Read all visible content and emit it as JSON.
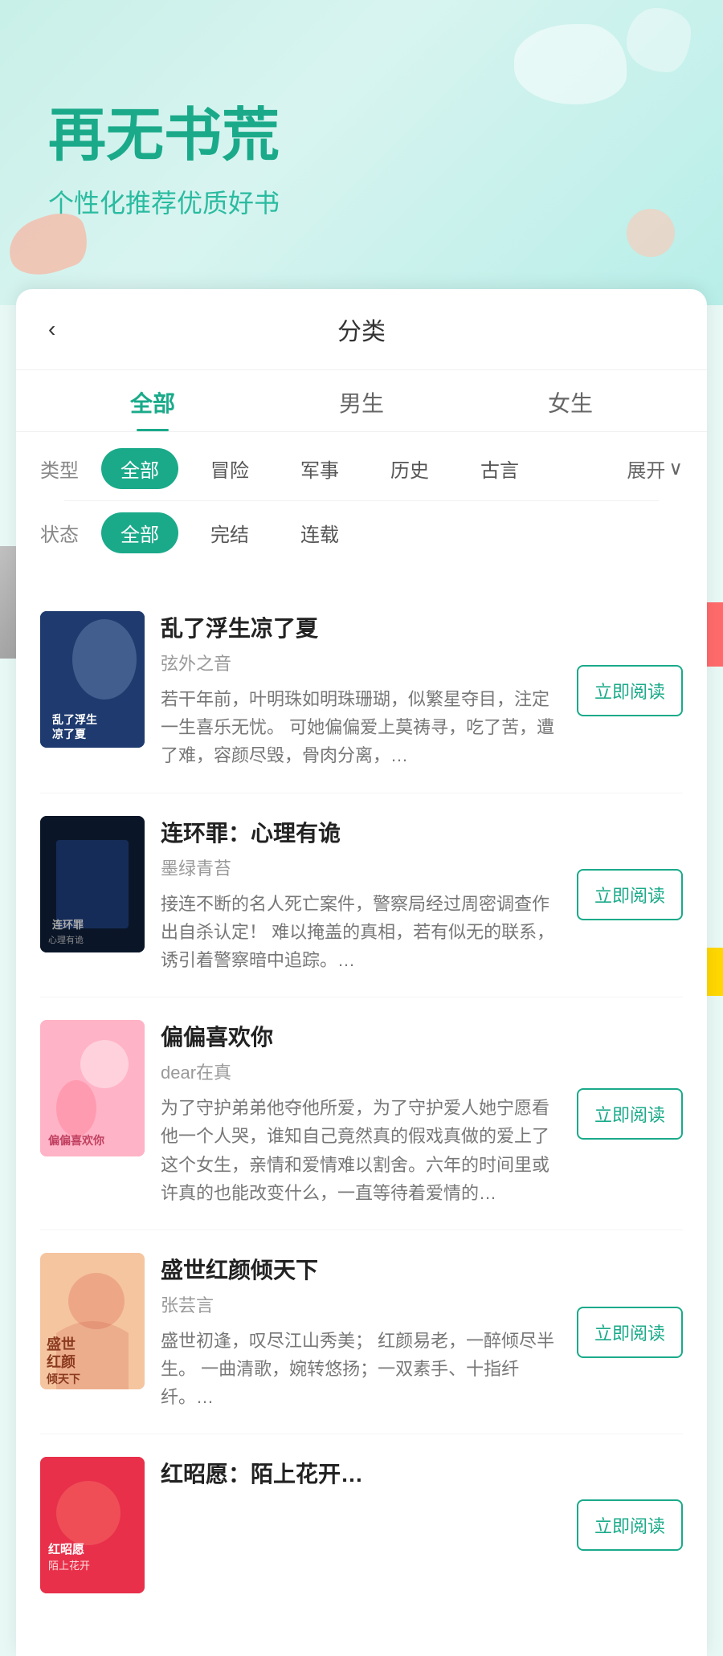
{
  "hero": {
    "title": "再无书荒",
    "subtitle": "个性化推荐优质好书"
  },
  "header": {
    "back_label": "‹",
    "title": "分类"
  },
  "tabs": [
    {
      "id": "all",
      "label": "全部",
      "active": true
    },
    {
      "id": "male",
      "label": "男生",
      "active": false
    },
    {
      "id": "female",
      "label": "女生",
      "active": false
    }
  ],
  "filters": {
    "type": {
      "label": "类型",
      "expand_label": "展开",
      "options": [
        {
          "id": "all",
          "label": "全部",
          "active": true
        },
        {
          "id": "adventure",
          "label": "冒险",
          "active": false
        },
        {
          "id": "military",
          "label": "军事",
          "active": false
        },
        {
          "id": "history",
          "label": "历史",
          "active": false
        },
        {
          "id": "ancient",
          "label": "古言",
          "active": false
        }
      ]
    },
    "status": {
      "label": "状态",
      "options": [
        {
          "id": "all",
          "label": "全部",
          "active": true
        },
        {
          "id": "completed",
          "label": "完结",
          "active": false
        },
        {
          "id": "ongoing",
          "label": "连载",
          "active": false
        }
      ]
    }
  },
  "books": [
    {
      "id": 1,
      "title": "乱了浮生凉了夏",
      "author": "弦外之音",
      "description": "若干年前，叶明珠如明珠珊瑚，似繁星夺目，注定一生喜乐无忧。\n可她偏偏爱上莫祷寻，吃了苦，遭了难，容颜尽毁，骨肉分离，…",
      "cover_style": "cover-1",
      "cover_text": "乱了浮生\n凉了夏",
      "read_btn": "立即阅读"
    },
    {
      "id": 2,
      "title": "连环罪：心理有诡",
      "author": "墨绿青苔",
      "description": "接连不断的名人死亡案件，警察局经过周密调查作出自杀认定！\n难以掩盖的真相，若有似无的联系，诱引着警察暗中追踪。…",
      "cover_style": "cover-2",
      "cover_text": "连环罪\n心理有诡",
      "read_btn": "立即阅读"
    },
    {
      "id": 3,
      "title": "偏偏喜欢你",
      "author": "dear在真",
      "description": "为了守护弟弟他夺他所爱，为了守护爱人她宁愿看他一个人哭，谁知自己竟然真的假戏真做的爱上了这个女生，亲情和爱情难以割舍。六年的时间里或许真的也能改变什么，一直等待着爱情的…",
      "cover_style": "cover-3",
      "cover_text": "偏偏喜欢你",
      "read_btn": "立即阅读"
    },
    {
      "id": 4,
      "title": "盛世红颜倾天下",
      "author": "张芸言",
      "description": "盛世初逢，叹尽江山秀美；\n红颜易老，一醉倾尽半生。\n一曲清歌，婉转悠扬；一双素手、十指纤纤。…",
      "cover_style": "cover-4",
      "cover_text": "盛世\n红颜\n倾天下",
      "read_btn": "立即阅读"
    },
    {
      "id": 5,
      "title": "红昭愿：陌上花开…",
      "author": "",
      "description": "",
      "cover_style": "cover-5",
      "cover_text": "红昭愿\n陌上花开",
      "read_btn": "立即阅读"
    }
  ]
}
